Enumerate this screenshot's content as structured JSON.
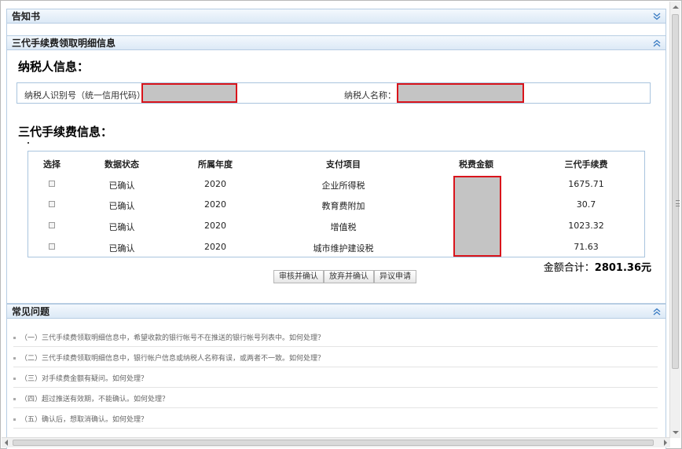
{
  "notice_panel": {
    "title": "告知书"
  },
  "detail_panel": {
    "title": "三代手续费领取明细信息",
    "taxpayer_heading": "纳税人信息：",
    "taxpayer_id_label": "纳税人识别号（统一信用代码）：",
    "taxpayer_name_label": "纳税人名称：",
    "fee_heading": "三代手续费信息：",
    "columns": [
      "选择",
      "数据状态",
      "所属年度",
      "支付项目",
      "税费金额",
      "三代手续费"
    ],
    "rows": [
      {
        "status": "已确认",
        "year": "2020",
        "item": "企业所得税",
        "fee": "1675.71"
      },
      {
        "status": "已确认",
        "year": "2020",
        "item": "教育费附加",
        "fee": "30.7"
      },
      {
        "status": "已确认",
        "year": "2020",
        "item": "增值税",
        "fee": "1023.32"
      },
      {
        "status": "已确认",
        "year": "2020",
        "item": "城市维护建设税",
        "fee": "71.63"
      }
    ],
    "total_label": "金额合计：",
    "total_value": "2801.36元",
    "buttons": {
      "approve": "审核并确认",
      "reject": "放弃并确认",
      "dispute": "异议申请"
    }
  },
  "faq_panel": {
    "title": "常见问题",
    "items": [
      "（一）三代手续费领取明细信息中，希望收款的银行帐号不在推送的银行帐号列表中。如何处理？",
      "（二）三代手续费领取明细信息中，银行帐户信息或纳税人名称有误，或两者不一致。如何处理？",
      "（三）对手续费金额有疑问。如何处理？",
      "（四）超过推送有效期，不能确认。如何处理？",
      "（五）确认后，想取消确认。如何处理？"
    ]
  },
  "colors": {
    "panel_border": "#b7cde3",
    "mask_border": "#d9141b",
    "mask_fill": "#c4c4c4",
    "toggle_blue": "#3d7ec4"
  },
  "icons": {
    "collapse": "double-chevron-down-icon",
    "expand": "double-chevron-up-icon"
  }
}
